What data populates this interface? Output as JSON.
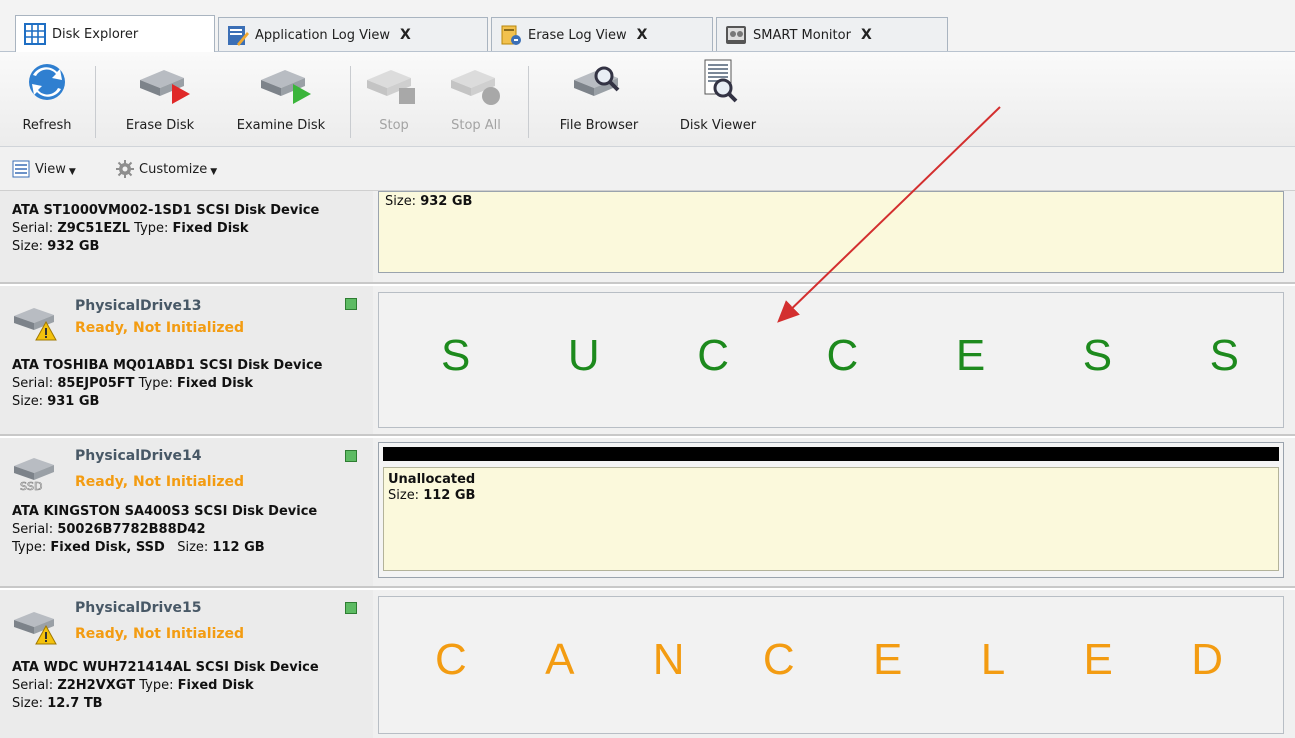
{
  "tabs": [
    {
      "label": "Disk Explorer",
      "icon": "grid-icon",
      "closable": false,
      "active": true
    },
    {
      "label": "Application Log View",
      "icon": "log-edit-icon",
      "closable": true,
      "active": false
    },
    {
      "label": "Erase Log View",
      "icon": "erase-log-icon",
      "closable": true,
      "active": false
    },
    {
      "label": "SMART Monitor",
      "icon": "smart-monitor-icon",
      "closable": true,
      "active": false
    }
  ],
  "tab_close_glyph": "X",
  "toolbar": {
    "refresh": "Refresh",
    "erase_disk": "Erase Disk",
    "examine_disk": "Examine Disk",
    "stop": "Stop",
    "stop_all": "Stop All",
    "file_browser": "File Browser",
    "disk_viewer": "Disk Viewer"
  },
  "subbar": {
    "view": "View",
    "customize": "Customize"
  },
  "drives": [
    {
      "model": "ATA ST1000VM002-1SD1 SCSI Disk Device",
      "serial_label": "Serial:",
      "serial": "Z9C51EZL",
      "type_label": "Type:",
      "type": "Fixed Disk",
      "size_label": "Size:",
      "size": "932 GB",
      "panel_size_label": "Size:",
      "panel_size": "932 GB"
    },
    {
      "name": "PhysicalDrive13",
      "status": "Ready, Not Initialized",
      "model": "ATA TOSHIBA MQ01ABD1 SCSI Disk Device",
      "serial_label": "Serial:",
      "serial": "85EJP05FT",
      "type_label": "Type:",
      "type": "Fixed Disk",
      "size_label": "Size:",
      "size": "931 GB",
      "result": "SUCCESS"
    },
    {
      "name": "PhysicalDrive14",
      "status": "Ready, Not Initialized",
      "model": "ATA KINGSTON SA400S3 SCSI Disk Device",
      "serial_label": "Serial:",
      "serial": "50026B7782B88D42",
      "type_label": "Type:",
      "type": "Fixed Disk, SSD",
      "size_label": "Size:",
      "size": "112 GB",
      "icon_badge": "SSD",
      "panel_title": "Unallocated",
      "panel_size_label": "Size:",
      "panel_size": "112 GB"
    },
    {
      "name": "PhysicalDrive15",
      "status": "Ready, Not Initialized",
      "model": "ATA WDC WUH721414AL SCSI Disk Device",
      "serial_label": "Serial:",
      "serial": "Z2H2VXGT",
      "type_label": "Type:",
      "type": "Fixed Disk",
      "size_label": "Size:",
      "size": "12.7 TB",
      "result": "CANCELED"
    }
  ],
  "colors": {
    "success": "#1d8a1d",
    "canceled": "#f39c12",
    "status_warning": "#f39c12",
    "annotation_arrow": "#d32f2f",
    "led_green": "#5dbb63"
  }
}
